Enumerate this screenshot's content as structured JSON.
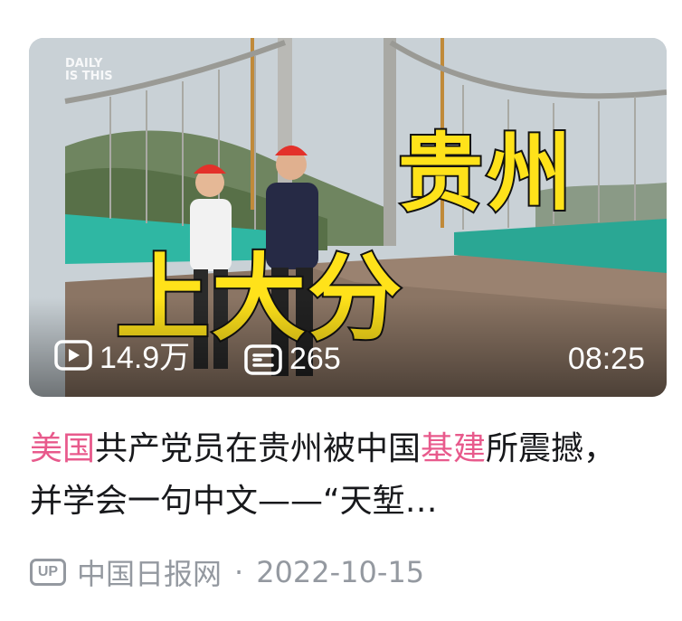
{
  "video": {
    "overlay_line1": "贵州",
    "overlay_line2": "上大分",
    "watermark": "DAILY\nIS THIS",
    "views": "14.9万",
    "danmaku": "265",
    "duration": "08:25"
  },
  "title_segments": [
    {
      "text": "美国",
      "highlight": true
    },
    {
      "text": "共产党员在贵州被中国",
      "highlight": false
    },
    {
      "text": "基建",
      "highlight": true
    },
    {
      "text": "所震撼，并学会一句中文——“天堑…",
      "highlight": false
    }
  ],
  "meta": {
    "up_badge": "UP",
    "author": "中国日报网",
    "separator": "·",
    "date": "2022-10-15"
  },
  "colors": {
    "highlight": "#e85a8c",
    "meta": "#9499a0",
    "overlay_text": "#ffe21a"
  }
}
